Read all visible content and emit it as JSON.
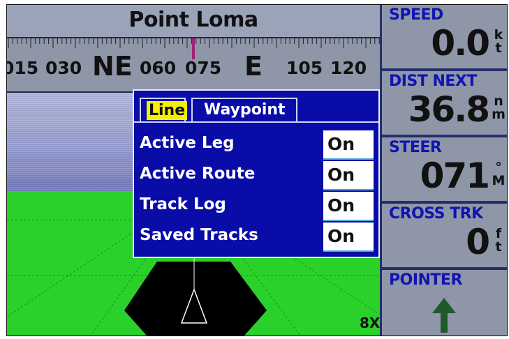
{
  "map": {
    "title": "Point Loma",
    "zoom": "8X"
  },
  "compass": {
    "labels": [
      "015",
      "030",
      "NE",
      "060",
      "075",
      "E",
      "105",
      "120"
    ]
  },
  "dialog": {
    "tabs": {
      "line": "Line",
      "waypoint": "Waypoint"
    },
    "options": [
      {
        "label": "Active Leg",
        "value": "On"
      },
      {
        "label": "Active Route",
        "value": "On"
      },
      {
        "label": "Track Log",
        "value": "On"
      },
      {
        "label": "Saved Tracks",
        "value": "On"
      }
    ]
  },
  "fields": {
    "speed": {
      "label": "SPEED",
      "value": "0.0",
      "unit_top": "k",
      "unit_bottom": "t"
    },
    "dist_next": {
      "label": "DIST NEXT",
      "value": "36.8",
      "unit_top": "n",
      "unit_bottom": "m"
    },
    "steer": {
      "label": "STEER",
      "value": "071",
      "unit_top": "°",
      "unit_bottom": "M"
    },
    "cross_trk": {
      "label": "CROSS TRK",
      "value": "0",
      "unit_top": "f",
      "unit_bottom": "t"
    },
    "pointer": {
      "label": "POINTER",
      "icon": "arrow-up-icon"
    }
  },
  "colors": {
    "field_label": "#1014b0",
    "dialog_bg": "#0a0ca8",
    "active_tab": "#f4f000",
    "ground": "#2bd12b",
    "heading_marker": "#a0227a",
    "pointer_arrow": "#1f5a2a"
  }
}
